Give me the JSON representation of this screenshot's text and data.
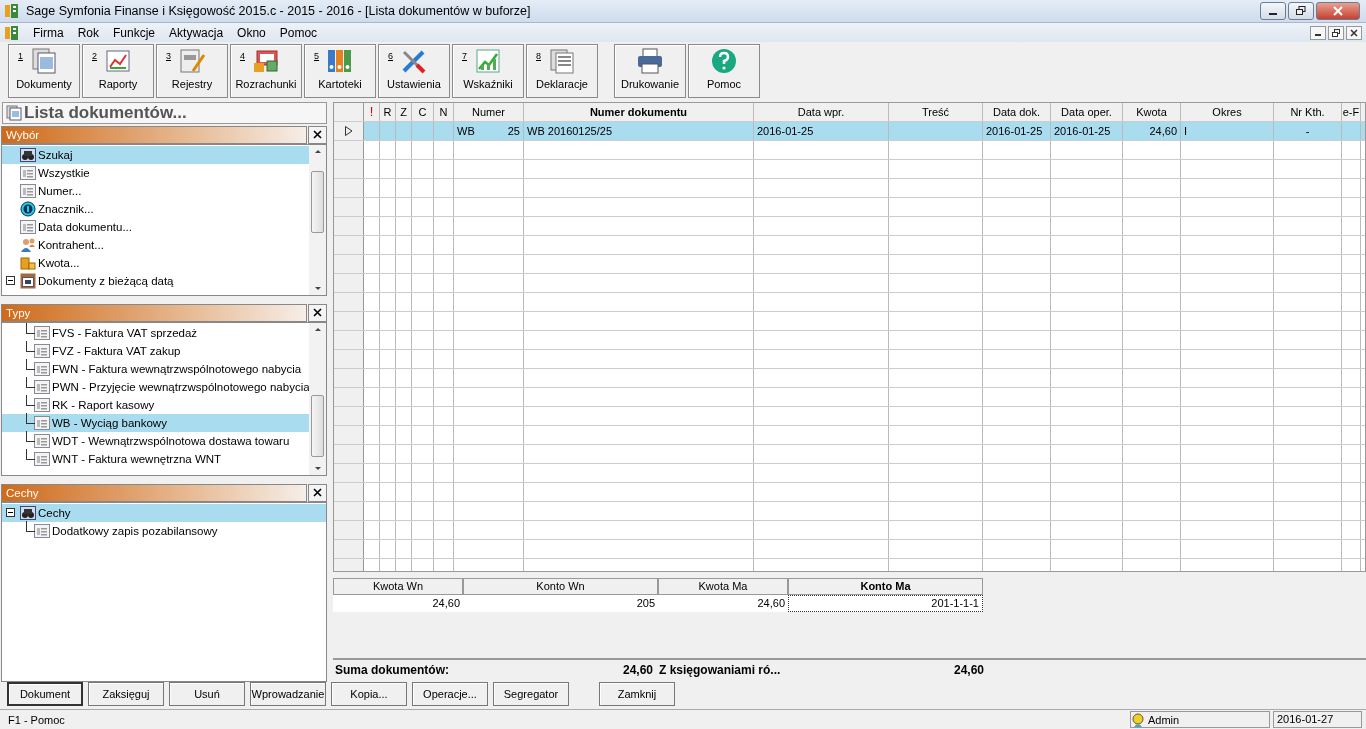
{
  "window": {
    "title": "Sage Symfonia Finanse i Księgowość 2015.c - 2015 - 2016 - [Lista dokumentów w buforze]"
  },
  "menu": [
    "Firma",
    "Rok",
    "Funkcje",
    "Aktywacja",
    "Okno",
    "Pomoc"
  ],
  "toolbar": [
    {
      "number": "1",
      "label": "Dokumenty"
    },
    {
      "number": "2",
      "label": "Raporty"
    },
    {
      "number": "3",
      "label": "Rejestry"
    },
    {
      "number": "4",
      "label": "Rozrachunki"
    },
    {
      "number": "5",
      "label": "Kartoteki"
    },
    {
      "number": "6",
      "label": "Ustawienia"
    },
    {
      "number": "7",
      "label": "Wskaźniki"
    },
    {
      "number": "8",
      "label": "Deklaracje"
    },
    {
      "label": "Drukowanie"
    },
    {
      "label": "Pomoc"
    }
  ],
  "sidebar": {
    "title": "Lista dokumentów...",
    "panels": [
      {
        "title": "Wybór",
        "items": [
          {
            "label": "Szukaj",
            "kind": "search",
            "selected": true
          },
          {
            "label": "Wszystkie",
            "kind": "list",
            "selected": false
          },
          {
            "label": "Numer...",
            "kind": "list",
            "selected": false
          },
          {
            "label": "Znacznik...",
            "kind": "marker",
            "selected": false
          },
          {
            "label": "Data dokumentu...",
            "kind": "list",
            "selected": false
          },
          {
            "label": "Kontrahent...",
            "kind": "person",
            "selected": false
          },
          {
            "label": "Kwota...",
            "kind": "money",
            "selected": false
          },
          {
            "label": "Dokumenty z bieżącą datą",
            "kind": "calendar",
            "selected": false,
            "expanded": true
          }
        ]
      },
      {
        "title": "Typy",
        "items": [
          {
            "label": "FVS - Faktura VAT sprzedaż",
            "kind": "child",
            "selected": false
          },
          {
            "label": "FVZ - Faktura VAT zakup",
            "kind": "child",
            "selected": false
          },
          {
            "label": "FWN - Faktura wewnątrzwspólnotowego nabycia",
            "kind": "child",
            "selected": false
          },
          {
            "label": "PWN - Przyjęcie wewnątrzwspólnotowego nabycia",
            "kind": "child",
            "selected": false
          },
          {
            "label": "RK - Raport kasowy",
            "kind": "child",
            "selected": false
          },
          {
            "label": "WB - Wyciąg bankowy",
            "kind": "child",
            "selected": true
          },
          {
            "label": "WDT - Wewnątrzwspólnotowa dostawa towaru",
            "kind": "child",
            "selected": false
          },
          {
            "label": "WNT - Faktura wewnętrzna WNT",
            "kind": "child",
            "selected": false
          }
        ]
      },
      {
        "title": "Cechy",
        "items": [
          {
            "label": "Cechy",
            "kind": "search",
            "selected": true,
            "expanded": true,
            "children": [
              {
                "label": "Dodatkowy zapis pozabilansowy",
                "kind": "child",
                "selected": false
              }
            ]
          }
        ]
      }
    ]
  },
  "table": {
    "columns": [
      {
        "label": "!",
        "sorted": false
      },
      {
        "label": "R",
        "sorted": false
      },
      {
        "label": "Z",
        "sorted": false
      },
      {
        "label": "C",
        "sorted": false
      },
      {
        "label": "N",
        "sorted": false
      },
      {
        "label": "Numer",
        "sorted": false
      },
      {
        "label": "Numer dokumentu",
        "sorted": true
      },
      {
        "label": "Data wpr.",
        "sorted": false
      },
      {
        "label": "Treść",
        "sorted": false
      },
      {
        "label": "Data dok.",
        "sorted": false
      },
      {
        "label": "Data oper.",
        "sorted": false
      },
      {
        "label": "Kwota",
        "sorted": false
      },
      {
        "label": "Okres",
        "sorted": false
      },
      {
        "label": "Nr Kth.",
        "sorted": false
      },
      {
        "label": "e-F",
        "sorted": false
      }
    ],
    "rows": [
      {
        "selected": true,
        "numer_prefix": "WB",
        "numer_no": "25",
        "numer_dokumentu": "WB 20160125/25",
        "data_wpr": "2016-01-25",
        "data_dok": "2016-01-25",
        "data_oper": "2016-01-25",
        "kwota": "24,60",
        "okres": "I",
        "nr_kth": "-"
      }
    ]
  },
  "entries": {
    "columns": [
      {
        "label": "Kwota Wn",
        "sorted": false
      },
      {
        "label": "Konto Wn",
        "sorted": false
      },
      {
        "label": "Kwota Ma",
        "sorted": false
      },
      {
        "label": "Konto Ma",
        "sorted": true
      }
    ],
    "rows": [
      {
        "cells": [
          {
            "text": "24,60",
            "focused": false
          },
          {
            "text": "205",
            "focused": false
          },
          {
            "text": "24,60",
            "focused": false
          },
          {
            "text": "201-1-1-1",
            "focused": true
          }
        ]
      }
    ]
  },
  "summary": {
    "label": "Suma dokumentów:",
    "value": "24,60",
    "label_2": "Z księgowaniami ró...",
    "value_2": "24,60"
  },
  "buttons": [
    {
      "label": "Dokument",
      "default": true
    },
    {
      "label": "Zaksięguj",
      "default": false
    },
    {
      "label": "Usuń",
      "default": false
    },
    {
      "label": "Wprowadzanie",
      "default": false
    },
    {
      "label": "Kopia...",
      "default": false
    },
    {
      "label": "Operacje...",
      "default": false
    },
    {
      "label": "Segregator",
      "default": false
    },
    {
      "label": "Zamknij",
      "default": false
    }
  ],
  "status_bar": {
    "help": "F1 - Pomoc",
    "user": "Admin",
    "date": "2016-01-27"
  }
}
